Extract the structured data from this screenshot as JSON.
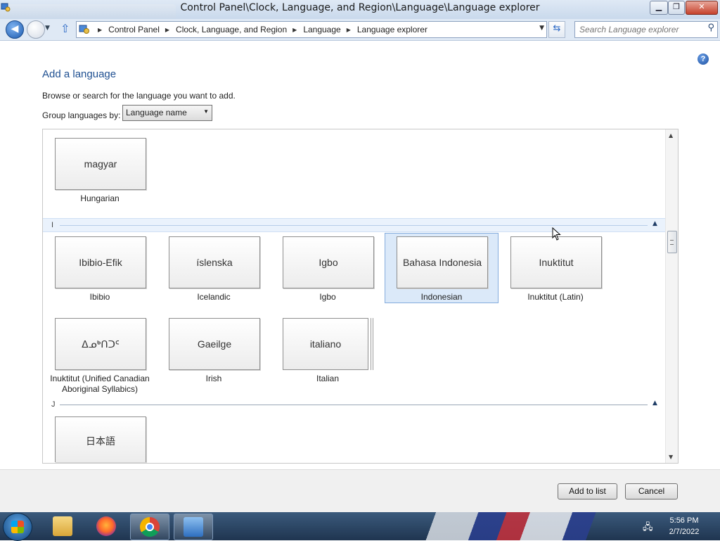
{
  "window": {
    "title": "Control Panel\\Clock, Language, and Region\\Language\\Language explorer",
    "minimize_label": "▁",
    "maximize_label": "❐",
    "close_label": "✕"
  },
  "address": {
    "crumbs": [
      "Control Panel",
      "Clock, Language, and Region",
      "Language",
      "Language explorer"
    ],
    "search_placeholder": "Search Language explorer"
  },
  "page": {
    "heading": "Add a language",
    "description": "Browse or search for the language you want to add.",
    "group_label": "Group languages by:",
    "group_value": "Language name",
    "help_label": "?"
  },
  "groups": {
    "i_letter": "I",
    "j_letter": "J"
  },
  "languages": {
    "hungarian": {
      "native": "magyar",
      "english": "Hungarian"
    },
    "ibibio": {
      "native": "Ibibio-Efik",
      "english": "Ibibio"
    },
    "icelandic": {
      "native": "íslenska",
      "english": "Icelandic"
    },
    "igbo": {
      "native": "Igbo",
      "english": "Igbo"
    },
    "indonesian": {
      "native": "Bahasa Indonesia",
      "english": "Indonesian"
    },
    "inuktitut_latin": {
      "native": "Inuktitut",
      "english": "Inuktitut (Latin)"
    },
    "inuktitut_syll": {
      "native": "ᐃᓄᒃᑎᑐᑦ",
      "english_line1": "Inuktitut (Unified Canadian",
      "english_line2": "Aboriginal Syllabics)"
    },
    "irish": {
      "native": "Gaeilge",
      "english": "Irish"
    },
    "italian": {
      "native": "italiano",
      "english": "Italian"
    },
    "japanese": {
      "native": "日本語"
    }
  },
  "footer": {
    "add_label": "Add to list",
    "cancel_label": "Cancel"
  },
  "taskbar": {
    "time": "5:56 PM",
    "date": "2/7/2022"
  }
}
